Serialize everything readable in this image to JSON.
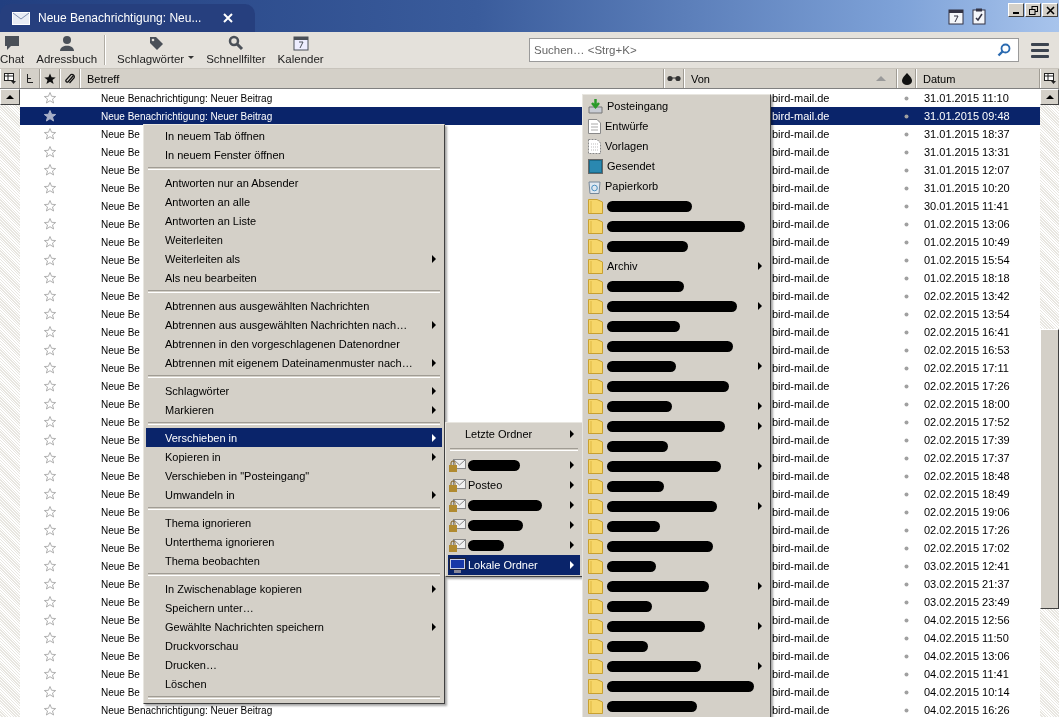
{
  "window": {
    "tab_title": "Neue Benachrichtigung: Neu..."
  },
  "toolbar": {
    "buttons": [
      {
        "kind": "chat",
        "label": "Chat",
        "dropdown": false
      },
      {
        "kind": "contacts",
        "label": "Adressbuch",
        "dropdown": false
      },
      {
        "kind": "tag",
        "label": "Schlagwörter",
        "dropdown": true
      },
      {
        "kind": "filter",
        "label": "Schnellfilter",
        "dropdown": false
      },
      {
        "kind": "calendar",
        "label": "Kalender",
        "dropdown": false
      }
    ],
    "search": {
      "placeholder": "Suchen… <Strg+K>"
    }
  },
  "message_list": {
    "columns": [
      {
        "kind": "thread"
      },
      {
        "kind": "star"
      },
      {
        "kind": "attachment"
      },
      {
        "kind": "text",
        "label": "Betreff",
        "sorted": false
      },
      {
        "kind": "read"
      },
      {
        "kind": "text",
        "label": "Von",
        "sorted": true
      },
      {
        "kind": "junk"
      },
      {
        "kind": "text",
        "label": "Datum",
        "sorted": false
      }
    ],
    "rows": [
      {
        "subject": "Neue Benachrichtigung: Neuer Beitrag",
        "sender": "bird-mail.de",
        "date": "31.01.2015 11:10",
        "selected": false
      },
      {
        "subject": "Neue Benachrichtigung: Neuer Beitrag",
        "sender": "bird-mail.de",
        "date": "31.01.2015 09:48",
        "selected": true
      },
      {
        "subject": "Neue Be",
        "sender": "bird-mail.de",
        "date": "31.01.2015 18:37",
        "selected": false
      },
      {
        "subject": "Neue Be",
        "sender": "bird-mail.de",
        "date": "31.01.2015 13:31",
        "selected": false
      },
      {
        "subject": "Neue Be",
        "sender": "bird-mail.de",
        "date": "31.01.2015 12:07",
        "selected": false
      },
      {
        "subject": "Neue Be",
        "sender": "bird-mail.de",
        "date": "31.01.2015 10:20",
        "selected": false
      },
      {
        "subject": "Neue Be",
        "sender": "bird-mail.de",
        "date": "30.01.2015 11:41",
        "selected": false
      },
      {
        "subject": "Neue Be",
        "sender": "bird-mail.de",
        "date": "01.02.2015 13:06",
        "selected": false
      },
      {
        "subject": "Neue Be",
        "sender": "bird-mail.de",
        "date": "01.02.2015 10:49",
        "selected": false
      },
      {
        "subject": "Neue Be",
        "sender": "bird-mail.de",
        "date": "01.02.2015 15:54",
        "selected": false
      },
      {
        "subject": "Neue Be",
        "sender": "bird-mail.de",
        "date": "01.02.2015 18:18",
        "selected": false
      },
      {
        "subject": "Neue Be",
        "sender": "bird-mail.de",
        "date": "02.02.2015 13:42",
        "selected": false
      },
      {
        "subject": "Neue Be",
        "sender": "bird-mail.de",
        "date": "02.02.2015 13:54",
        "selected": false
      },
      {
        "subject": "Neue Be",
        "sender": "bird-mail.de",
        "date": "02.02.2015 16:41",
        "selected": false
      },
      {
        "subject": "Neue Be",
        "sender": "bird-mail.de",
        "date": "02.02.2015 16:53",
        "selected": false
      },
      {
        "subject": "Neue Be",
        "sender": "bird-mail.de",
        "date": "02.02.2015 17:11",
        "selected": false
      },
      {
        "subject": "Neue Be",
        "sender": "bird-mail.de",
        "date": "02.02.2015 17:26",
        "selected": false
      },
      {
        "subject": "Neue Be",
        "sender": "bird-mail.de",
        "date": "02.02.2015 18:00",
        "selected": false
      },
      {
        "subject": "Neue Be",
        "sender": "bird-mail.de",
        "date": "02.02.2015 17:52",
        "selected": false
      },
      {
        "subject": "Neue Be",
        "sender": "bird-mail.de",
        "date": "02.02.2015 17:39",
        "selected": false
      },
      {
        "subject": "Neue Be",
        "sender": "bird-mail.de",
        "date": "02.02.2015 17:37",
        "selected": false
      },
      {
        "subject": "Neue Be",
        "sender": "bird-mail.de",
        "date": "02.02.2015 18:48",
        "selected": false
      },
      {
        "subject": "Neue Be",
        "sender": "bird-mail.de",
        "date": "02.02.2015 18:49",
        "selected": false
      },
      {
        "subject": "Neue Be",
        "sender": "bird-mail.de",
        "date": "02.02.2015 19:06",
        "selected": false
      },
      {
        "subject": "Neue Be",
        "sender": "bird-mail.de",
        "date": "02.02.2015 17:26",
        "selected": false
      },
      {
        "subject": "Neue Be",
        "sender": "bird-mail.de",
        "date": "02.02.2015 17:02",
        "selected": false
      },
      {
        "subject": "Neue Be",
        "sender": "bird-mail.de",
        "date": "03.02.2015 12:41",
        "selected": false
      },
      {
        "subject": "Neue Be",
        "sender": "bird-mail.de",
        "date": "03.02.2015 21:37",
        "selected": false
      },
      {
        "subject": "Neue Be",
        "sender": "bird-mail.de",
        "date": "03.02.2015 23:49",
        "selected": false
      },
      {
        "subject": "Neue Be",
        "sender": "bird-mail.de",
        "date": "04.02.2015 12:56",
        "selected": false
      },
      {
        "subject": "Neue Be",
        "sender": "bird-mail.de",
        "date": "04.02.2015 11:50",
        "selected": false
      },
      {
        "subject": "Neue Be",
        "sender": "bird-mail.de",
        "date": "04.02.2015 13:06",
        "selected": false
      },
      {
        "subject": "Neue Be",
        "sender": "bird-mail.de",
        "date": "04.02.2015 11:41",
        "selected": false
      },
      {
        "subject": "Neue Be",
        "sender": "bird-mail.de",
        "date": "04.02.2015 10:14",
        "selected": false
      },
      {
        "subject": "Neue Benachrichtigung: Neuer Beitrag",
        "sender": "bird-mail.de",
        "date": "04.02.2015 16:26",
        "selected": false
      }
    ]
  },
  "context_menu": {
    "items": [
      {
        "kind": "item",
        "label": "In neuem Tab öffnen",
        "submenu": false,
        "selected": false
      },
      {
        "kind": "item",
        "label": "In neuem Fenster öffnen",
        "submenu": false,
        "selected": false
      },
      {
        "kind": "separator"
      },
      {
        "kind": "item",
        "label": "Antworten nur an Absender",
        "submenu": false,
        "selected": false
      },
      {
        "kind": "item",
        "label": "Antworten an alle",
        "submenu": false,
        "selected": false
      },
      {
        "kind": "item",
        "label": "Antworten an Liste",
        "submenu": false,
        "selected": false
      },
      {
        "kind": "item",
        "label": "Weiterleiten",
        "submenu": false,
        "selected": false
      },
      {
        "kind": "item",
        "label": "Weiterleiten als",
        "submenu": true,
        "selected": false
      },
      {
        "kind": "item",
        "label": "Als neu bearbeiten",
        "submenu": false,
        "selected": false
      },
      {
        "kind": "separator"
      },
      {
        "kind": "item",
        "label": "Abtrennen aus ausgewählten Nachrichten",
        "submenu": false,
        "selected": false
      },
      {
        "kind": "item",
        "label": "Abtrennen aus ausgewählten Nachrichten nach…",
        "submenu": true,
        "selected": false
      },
      {
        "kind": "item",
        "label": "Abtrennen in den vorgeschlagenen Datenordner",
        "submenu": false,
        "selected": false
      },
      {
        "kind": "item",
        "label": "Abtrennen mit eigenem Dateinamenmuster nach…",
        "submenu": true,
        "selected": false
      },
      {
        "kind": "separator"
      },
      {
        "kind": "item",
        "label": "Schlagwörter",
        "submenu": true,
        "selected": false
      },
      {
        "kind": "item",
        "label": "Markieren",
        "submenu": true,
        "selected": false
      },
      {
        "kind": "separator"
      },
      {
        "kind": "item",
        "label": "Verschieben in",
        "submenu": true,
        "selected": true
      },
      {
        "kind": "item",
        "label": "Kopieren in",
        "submenu": true,
        "selected": false
      },
      {
        "kind": "item",
        "label": "Verschieben in \"Posteingang\"",
        "submenu": false,
        "selected": false
      },
      {
        "kind": "item",
        "label": "Umwandeln in",
        "submenu": true,
        "selected": false
      },
      {
        "kind": "separator"
      },
      {
        "kind": "item",
        "label": "Thema ignorieren",
        "submenu": false,
        "selected": false
      },
      {
        "kind": "item",
        "label": "Unterthema ignorieren",
        "submenu": false,
        "selected": false
      },
      {
        "kind": "item",
        "label": "Thema beobachten",
        "submenu": false,
        "selected": false
      },
      {
        "kind": "separator"
      },
      {
        "kind": "item",
        "label": "In Zwischenablage kopieren",
        "submenu": true,
        "selected": false
      },
      {
        "kind": "item",
        "label": "Speichern unter…",
        "submenu": false,
        "selected": false
      },
      {
        "kind": "item",
        "label": "Gewählte Nachrichten speichern",
        "submenu": true,
        "selected": false
      },
      {
        "kind": "item",
        "label": "Druckvorschau",
        "submenu": false,
        "selected": false
      },
      {
        "kind": "item",
        "label": "Drucken…",
        "submenu": false,
        "selected": false
      },
      {
        "kind": "item",
        "label": "Löschen",
        "submenu": false,
        "selected": false
      },
      {
        "kind": "separator"
      }
    ]
  },
  "move_submenu": {
    "items": [
      {
        "kind": "recent",
        "label": "Letzte Ordner",
        "selected": false
      },
      {
        "kind": "separator"
      },
      {
        "kind": "account",
        "redacted": true,
        "selected": false
      },
      {
        "kind": "account",
        "label": "Posteo",
        "redacted": false,
        "selected": false
      },
      {
        "kind": "account",
        "redacted": true,
        "selected": false
      },
      {
        "kind": "account",
        "redacted": true,
        "selected": false
      },
      {
        "kind": "account",
        "redacted": true,
        "selected": false
      },
      {
        "kind": "local",
        "label": "Lokale Ordner",
        "redacted": false,
        "selected": true
      }
    ]
  },
  "folder_menu": {
    "items": [
      {
        "kind": "inbox",
        "label": "Posteingang",
        "submenu": false,
        "redacted": false
      },
      {
        "kind": "drafts",
        "label": "Entwürfe",
        "submenu": false,
        "redacted": false
      },
      {
        "kind": "templates",
        "label": "Vorlagen",
        "submenu": false,
        "redacted": false
      },
      {
        "kind": "sent",
        "label": "Gesendet",
        "submenu": false,
        "redacted": false
      },
      {
        "kind": "trash",
        "label": "Papierkorb",
        "submenu": false,
        "redacted": false
      },
      {
        "kind": "folder",
        "submenu": false,
        "redacted": true
      },
      {
        "kind": "folder",
        "submenu": false,
        "redacted": true
      },
      {
        "kind": "folder",
        "submenu": false,
        "redacted": true
      },
      {
        "kind": "folder",
        "label": "Archiv",
        "submenu": true,
        "redacted": false
      },
      {
        "kind": "folder",
        "submenu": false,
        "redacted": true
      },
      {
        "kind": "folder",
        "submenu": true,
        "redacted": true
      },
      {
        "kind": "folder",
        "submenu": false,
        "redacted": true
      },
      {
        "kind": "folder",
        "submenu": false,
        "redacted": true
      },
      {
        "kind": "folder",
        "submenu": true,
        "redacted": true
      },
      {
        "kind": "folder",
        "submenu": false,
        "redacted": true
      },
      {
        "kind": "folder",
        "submenu": true,
        "redacted": true
      },
      {
        "kind": "folder",
        "submenu": true,
        "redacted": true
      },
      {
        "kind": "folder",
        "submenu": false,
        "redacted": true
      },
      {
        "kind": "folder",
        "submenu": true,
        "redacted": true
      },
      {
        "kind": "folder",
        "submenu": false,
        "redacted": true
      },
      {
        "kind": "folder",
        "submenu": true,
        "redacted": true
      },
      {
        "kind": "folder",
        "submenu": false,
        "redacted": true
      },
      {
        "kind": "folder",
        "submenu": false,
        "redacted": true
      },
      {
        "kind": "folder",
        "submenu": false,
        "redacted": true
      },
      {
        "kind": "folder",
        "submenu": true,
        "redacted": true
      },
      {
        "kind": "folder",
        "submenu": false,
        "redacted": true
      },
      {
        "kind": "folder",
        "submenu": true,
        "redacted": true
      },
      {
        "kind": "folder",
        "submenu": false,
        "redacted": true
      },
      {
        "kind": "folder",
        "submenu": true,
        "redacted": true
      },
      {
        "kind": "folder",
        "submenu": false,
        "redacted": true
      },
      {
        "kind": "folder",
        "submenu": false,
        "redacted": true
      }
    ]
  }
}
